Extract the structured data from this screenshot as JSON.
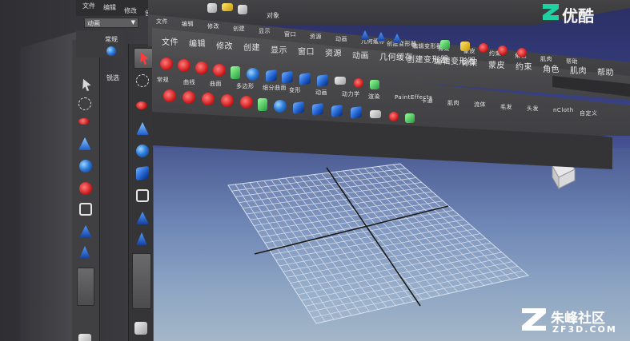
{
  "app": {
    "watermark_top": "优酷",
    "watermark_bottom_title": "朱峰社区",
    "watermark_bottom_sub": "ZF3D.COM"
  },
  "top_menu": {
    "items": [
      "文件",
      "编辑",
      "修改",
      "创建",
      "显示",
      "窗口",
      "资源",
      "动画",
      "几何缓存",
      "创建变形器",
      "编辑变形器",
      "骨架",
      "蒙皮",
      "约束",
      "角色",
      "肌肉",
      "帮助"
    ]
  },
  "far_menu": {
    "items": [
      "文件",
      "编辑",
      "修改",
      "创建"
    ],
    "mode_dropdown": "动画",
    "object_label": "对象"
  },
  "mid_menu": {
    "items": [
      "文件",
      "编辑",
      "修改",
      "创建",
      "显示",
      "窗口",
      "资源",
      "动画",
      "几何缓存",
      "创建变形器",
      "编辑变形器",
      "骨架",
      "蒙皮",
      "约束",
      "角色",
      "肌肉",
      "帮助"
    ]
  },
  "shelf_tabs": {
    "items": [
      "常规",
      "曲线",
      "曲面",
      "多边形",
      "细分曲面",
      "变形",
      "动画",
      "动力学",
      "渲染",
      "PaintEffects",
      "卡通",
      "肌肉",
      "流体",
      "毛发",
      "头发",
      "nCloth",
      "自定义"
    ]
  },
  "left_toolbar": {
    "tab_label": "常规",
    "tab_label2": "锐选"
  },
  "colors": {
    "panel_bg": "#3a3a3c",
    "grid_line": "#cfd8e6",
    "axis_line": "#1a1a1a"
  }
}
